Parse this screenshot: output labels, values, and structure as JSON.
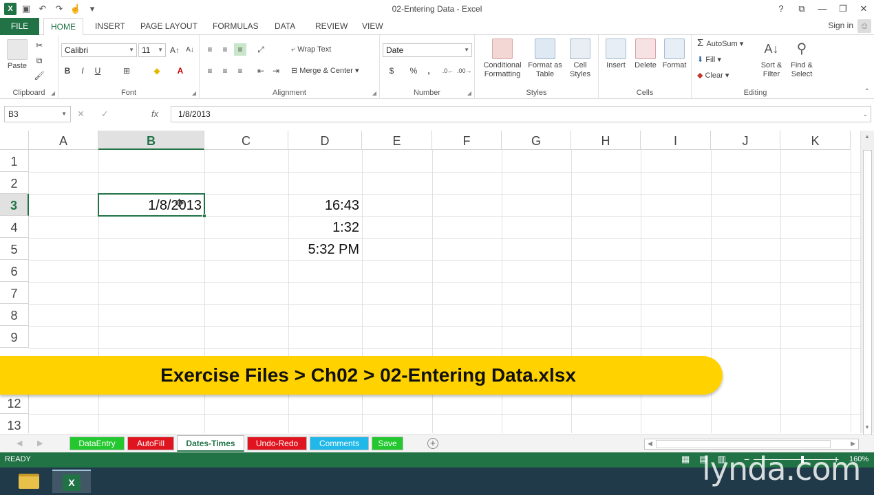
{
  "window": {
    "title": "02-Entering Data - Excel",
    "controls": [
      "?",
      "⧉",
      "—",
      "❐",
      "✕"
    ]
  },
  "ribbon_tabs": [
    {
      "label": "FILE"
    },
    {
      "label": "HOME"
    },
    {
      "label": "INSERT"
    },
    {
      "label": "PAGE LAYOUT"
    },
    {
      "label": "FORMULAS"
    },
    {
      "label": "DATA"
    },
    {
      "label": "REVIEW"
    },
    {
      "label": "VIEW"
    }
  ],
  "signin": "Sign in",
  "groups": {
    "clipboard": {
      "label": "Clipboard",
      "paste": "Paste"
    },
    "font": {
      "label": "Font",
      "font_name": "Calibri",
      "font_size": "11",
      "bold": "B",
      "italic": "I",
      "underline": "U"
    },
    "alignment": {
      "label": "Alignment",
      "wrap_text": "Wrap Text",
      "merge_center": "Merge & Center"
    },
    "number": {
      "label": "Number",
      "format": "Date",
      "currency": "$",
      "percent": "%",
      "comma": ","
    },
    "styles": {
      "label": "Styles",
      "conditional": "Conditional Formatting",
      "format_table": "Format as Table",
      "cell_styles": "Cell Styles"
    },
    "cells": {
      "label": "Cells",
      "insert": "Insert",
      "delete": "Delete",
      "format": "Format"
    },
    "editing": {
      "label": "Editing",
      "autosum": "AutoSum",
      "fill": "Fill",
      "clear": "Clear",
      "sort_filter": "Sort & Filter",
      "find_select": "Find & Select"
    }
  },
  "formula_bar": {
    "name_box": "B3",
    "content": "1/8/2013",
    "fx": "fx"
  },
  "columns": [
    "A",
    "B",
    "C",
    "D",
    "E",
    "F",
    "G",
    "H",
    "I",
    "J",
    "K"
  ],
  "rows": [
    "1",
    "2",
    "3",
    "4",
    "5",
    "6",
    "7",
    "8",
    "9",
    "12",
    "13"
  ],
  "cells": {
    "B3": "1/8/2013",
    "D3": "16:43",
    "D4": "1:32",
    "D5": "5:32 PM"
  },
  "banner": "Exercise Files > Ch02 > 02-Entering Data.xlsx",
  "sheet_tabs": [
    {
      "label": "DataEntry",
      "color": "#22c82e"
    },
    {
      "label": "AutoFill",
      "color": "#e0141e"
    },
    {
      "label": "Dates-Times",
      "color": "#ffffff"
    },
    {
      "label": "Undo-Redo",
      "color": "#e0141e"
    },
    {
      "label": "Comments",
      "color": "#1fb8e8"
    },
    {
      "label": "Save",
      "color": "#22c82e"
    }
  ],
  "status": {
    "ready": "READY",
    "zoom": "160%"
  },
  "watermark": "lynda.com",
  "colors": {
    "accent": "#217346",
    "banner": "#ffd200"
  }
}
